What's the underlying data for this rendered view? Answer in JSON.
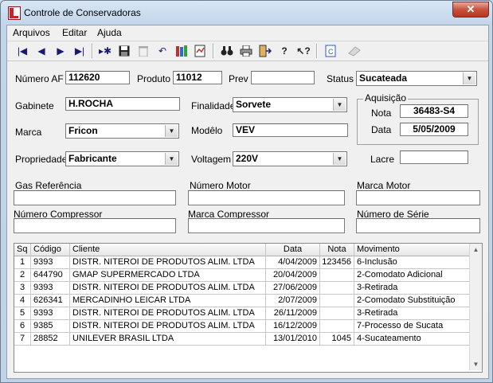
{
  "window": {
    "title": "Controle de Conservadoras",
    "close_label": "✕"
  },
  "menu": [
    "Arquivos",
    "Editar",
    "Ajuda"
  ],
  "toolbar_icons": [
    "first-record-icon",
    "prev-record-icon",
    "next-record-icon",
    "last-record-icon",
    "new-record-icon",
    "save-icon",
    "delete-icon",
    "undo-icon",
    "books-icon",
    "report-icon",
    "binoculars-icon",
    "print-icon",
    "exit-icon",
    "help-icon",
    "context-help-icon",
    "copy-icon",
    "eraser-icon"
  ],
  "form": {
    "numero_af": {
      "label": "Número AF",
      "value": "112620"
    },
    "produto": {
      "label": "Produto",
      "value": "11012"
    },
    "prev": {
      "label": "Prev",
      "value": ""
    },
    "status": {
      "label": "Status",
      "value": "Sucateada"
    },
    "gabinete": {
      "label": "Gabinete",
      "value": "H.ROCHA"
    },
    "finalidade": {
      "label": "Finalidade",
      "value": "Sorvete"
    },
    "aquisicao": {
      "label": "Aquisição",
      "nota_label": "Nota",
      "nota": "36483-S4",
      "data_label": "Data",
      "data": "5/05/2009"
    },
    "marca": {
      "label": "Marca",
      "value": "Fricon"
    },
    "modelo": {
      "label": "Modêlo",
      "value": "VEV"
    },
    "propriedade": {
      "label": "Propriedade",
      "value": "Fabricante"
    },
    "voltagem": {
      "label": "Voltagem",
      "value": "220V"
    },
    "lacre": {
      "label": "Lacre",
      "value": ""
    },
    "gas_referencia": {
      "label": "Gas Referência",
      "value": ""
    },
    "numero_motor": {
      "label": "Número Motor",
      "value": ""
    },
    "marca_motor": {
      "label": "Marca Motor",
      "value": ""
    },
    "numero_compressor": {
      "label": "Número Compressor",
      "value": ""
    },
    "marca_compressor": {
      "label": "Marca Compressor",
      "value": ""
    },
    "numero_serie": {
      "label": "Número de Série",
      "value": ""
    }
  },
  "grid": {
    "headers": {
      "sq": "Sq",
      "codigo": "Código",
      "cliente": "Cliente",
      "data": "Data",
      "nota": "Nota",
      "movimento": "Movimento"
    },
    "rows": [
      {
        "sq": "1",
        "codigo": "9393",
        "cliente": "DISTR. NITEROI DE PRODUTOS ALIM. LTDA",
        "data": "4/04/2009",
        "nota": "123456",
        "movimento": "6-Inclusão"
      },
      {
        "sq": "2",
        "codigo": "644790",
        "cliente": "GMAP SUPERMERCADO LTDA",
        "data": "20/04/2009",
        "nota": "",
        "movimento": "2-Comodato Adicional"
      },
      {
        "sq": "3",
        "codigo": "9393",
        "cliente": "DISTR. NITEROI DE PRODUTOS ALIM. LTDA",
        "data": "27/06/2009",
        "nota": "",
        "movimento": "3-Retirada"
      },
      {
        "sq": "4",
        "codigo": "626341",
        "cliente": "MERCADINHO LEICAR LTDA",
        "data": "2/07/2009",
        "nota": "",
        "movimento": "2-Comodato Substituição"
      },
      {
        "sq": "5",
        "codigo": "9393",
        "cliente": "DISTR. NITEROI DE PRODUTOS ALIM. LTDA",
        "data": "26/11/2009",
        "nota": "",
        "movimento": "3-Retirada"
      },
      {
        "sq": "6",
        "codigo": "9385",
        "cliente": "DISTR. NITEROI DE PRODUTOS ALIM. LTDA",
        "data": "16/12/2009",
        "nota": "",
        "movimento": "7-Processo de Sucata"
      },
      {
        "sq": "7",
        "codigo": "28852",
        "cliente": "UNILEVER BRASIL LTDA",
        "data": "13/01/2010",
        "nota": "1045",
        "movimento": "4-Sucateamento"
      }
    ]
  }
}
